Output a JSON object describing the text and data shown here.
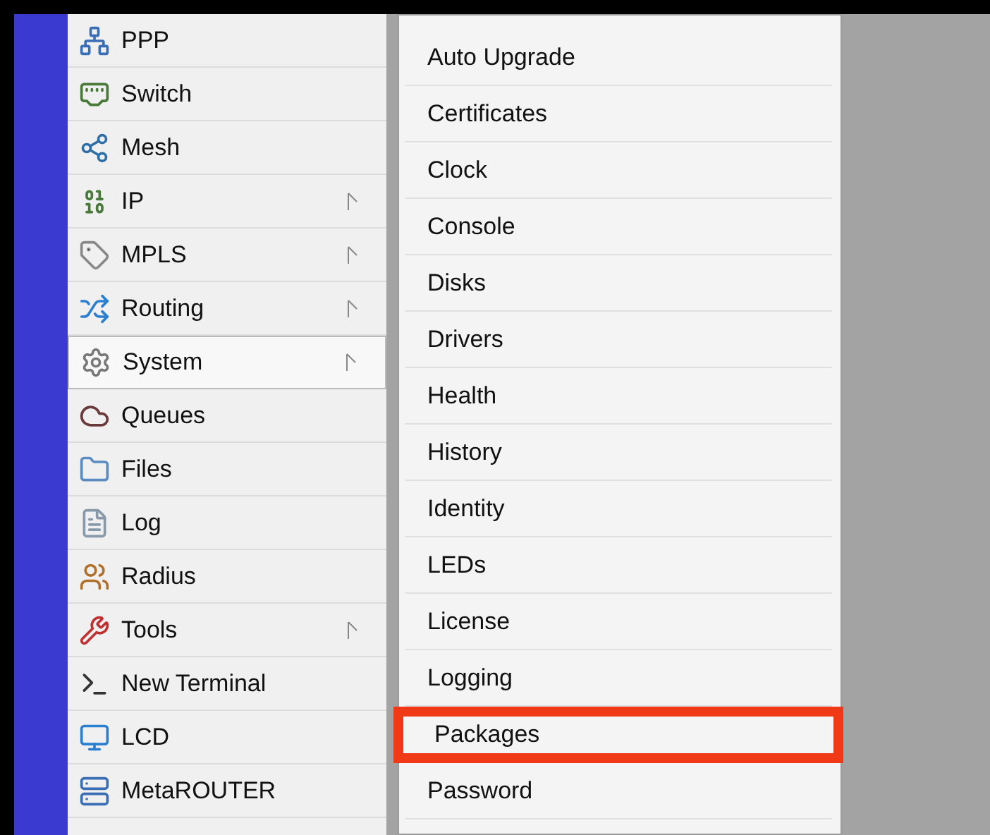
{
  "main_menu": {
    "items": [
      {
        "label": "PPP",
        "has_submenu": false,
        "selected": false
      },
      {
        "label": "Switch",
        "has_submenu": false,
        "selected": false
      },
      {
        "label": "Mesh",
        "has_submenu": false,
        "selected": false
      },
      {
        "label": "IP",
        "has_submenu": true,
        "selected": false
      },
      {
        "label": "MPLS",
        "has_submenu": true,
        "selected": false
      },
      {
        "label": "Routing",
        "has_submenu": true,
        "selected": false
      },
      {
        "label": "System",
        "has_submenu": true,
        "selected": true
      },
      {
        "label": "Queues",
        "has_submenu": false,
        "selected": false
      },
      {
        "label": "Files",
        "has_submenu": false,
        "selected": false
      },
      {
        "label": "Log",
        "has_submenu": false,
        "selected": false
      },
      {
        "label": "Radius",
        "has_submenu": false,
        "selected": false
      },
      {
        "label": "Tools",
        "has_submenu": true,
        "selected": false
      },
      {
        "label": "New Terminal",
        "has_submenu": false,
        "selected": false
      },
      {
        "label": "LCD",
        "has_submenu": false,
        "selected": false
      },
      {
        "label": "MetaROUTER",
        "has_submenu": false,
        "selected": false
      }
    ]
  },
  "submenu": {
    "items": [
      {
        "label": "Auto Upgrade",
        "highlighted": false
      },
      {
        "label": "Certificates",
        "highlighted": false
      },
      {
        "label": "Clock",
        "highlighted": false
      },
      {
        "label": "Console",
        "highlighted": false
      },
      {
        "label": "Disks",
        "highlighted": false
      },
      {
        "label": "Drivers",
        "highlighted": false
      },
      {
        "label": "Health",
        "highlighted": false
      },
      {
        "label": "History",
        "highlighted": false
      },
      {
        "label": "Identity",
        "highlighted": false
      },
      {
        "label": "LEDs",
        "highlighted": false
      },
      {
        "label": "License",
        "highlighted": false
      },
      {
        "label": "Logging",
        "highlighted": false
      },
      {
        "label": "Packages",
        "highlighted": true
      },
      {
        "label": "Password",
        "highlighted": false
      }
    ]
  }
}
